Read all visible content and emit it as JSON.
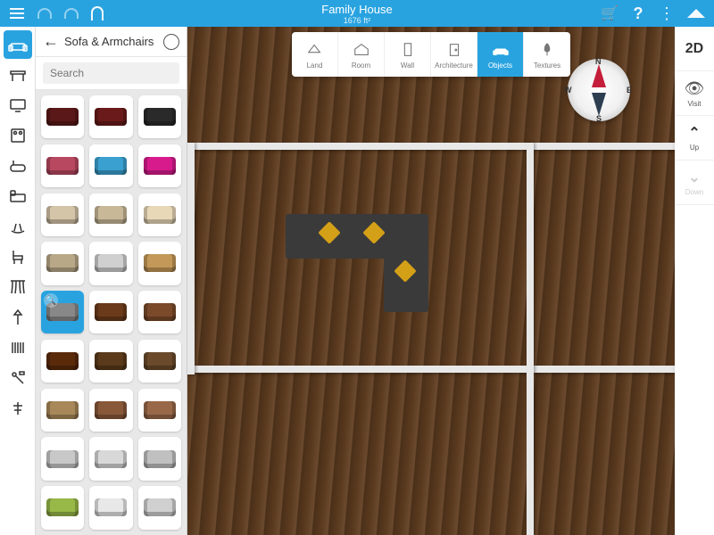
{
  "header": {
    "title": "Family House",
    "subtitle": "1676 ft²"
  },
  "panel": {
    "title": "Sofa & Armchairs",
    "search_placeholder": "Search"
  },
  "toolbar": [
    {
      "id": "land",
      "label": "Land"
    },
    {
      "id": "room",
      "label": "Room"
    },
    {
      "id": "wall",
      "label": "Wall"
    },
    {
      "id": "architecture",
      "label": "Architecture"
    },
    {
      "id": "objects",
      "label": "Objects",
      "active": true
    },
    {
      "id": "textures",
      "label": "Textures"
    }
  ],
  "rightbar": {
    "mode": "2D",
    "visit": "Visit",
    "up": "Up",
    "down": "Down"
  },
  "compass": {
    "n": "N",
    "s": "S",
    "e": "E",
    "w": "W"
  },
  "categories": [
    {
      "id": "sofa",
      "active": true
    },
    {
      "id": "table"
    },
    {
      "id": "tv"
    },
    {
      "id": "appliance"
    },
    {
      "id": "bathtub"
    },
    {
      "id": "bed"
    },
    {
      "id": "rocking"
    },
    {
      "id": "chair"
    },
    {
      "id": "curtain"
    },
    {
      "id": "lamp"
    },
    {
      "id": "radiator"
    },
    {
      "id": "tools"
    },
    {
      "id": "misc"
    }
  ],
  "items": [
    {
      "c": "#5a1818"
    },
    {
      "c": "#6a1a1a"
    },
    {
      "c": "#2a2a2a"
    },
    {
      "c": "#b84860"
    },
    {
      "c": "#3aa0d0"
    },
    {
      "c": "#d81b8c"
    },
    {
      "c": "#d4c4a8"
    },
    {
      "c": "#c8b898"
    },
    {
      "c": "#e8d8b8"
    },
    {
      "c": "#b8a888"
    },
    {
      "c": "#d0d0d0"
    },
    {
      "c": "#c49858"
    },
    {
      "c": "#888",
      "selected": true
    },
    {
      "c": "#6a3a1a"
    },
    {
      "c": "#7a4a2a"
    },
    {
      "c": "#5a2a0a"
    },
    {
      "c": "#5a3a1a"
    },
    {
      "c": "#6a4a2a"
    },
    {
      "c": "#a88858"
    },
    {
      "c": "#885838"
    },
    {
      "c": "#986848"
    },
    {
      "c": "#c8c8c8"
    },
    {
      "c": "#d8d8d8"
    },
    {
      "c": "#c0c0c0"
    },
    {
      "c": "#98b848"
    },
    {
      "c": "#e8e8e8"
    },
    {
      "c": "#d0d0d0"
    }
  ]
}
